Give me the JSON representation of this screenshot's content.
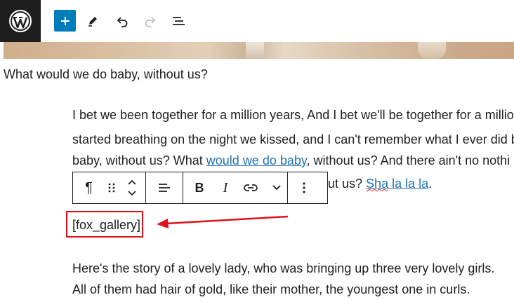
{
  "toolbar": {
    "logo_icon": "wordpress-logo-icon",
    "accent": "#007cba",
    "items": [
      "add-block-button",
      "edit-tools-button",
      "undo-button",
      "redo-button",
      "list-view-button"
    ]
  },
  "content": {
    "heading_line": "What would we do baby, without us?",
    "para1": {
      "line1": "I bet we been together for a million years, And I bet we'll be together for a millio",
      "line2": "started breathing on the night we kissed, and I can't remember what I ever did b",
      "line3_a": "baby, without us? What ",
      "line3_link": "would we do baby",
      "line3_b": ", without us? And there ain't no nothi",
      "line4_a": "ut us? ",
      "line4_link_a": "Sha",
      "line4_link_b": " la la la",
      "line4_end": "."
    },
    "shortcode": "[fox_gallery]",
    "para2": {
      "line1": "Here's the story of a lovely lady, who was bringing up three very lovely girls.",
      "line2": "All of them had hair of gold, like their mother, the youngest one in curls."
    }
  },
  "block_toolbar": {
    "paragraph_icon": "¶",
    "bold": "B",
    "italic": "I"
  },
  "annotation": {
    "color": "#e0101a"
  }
}
